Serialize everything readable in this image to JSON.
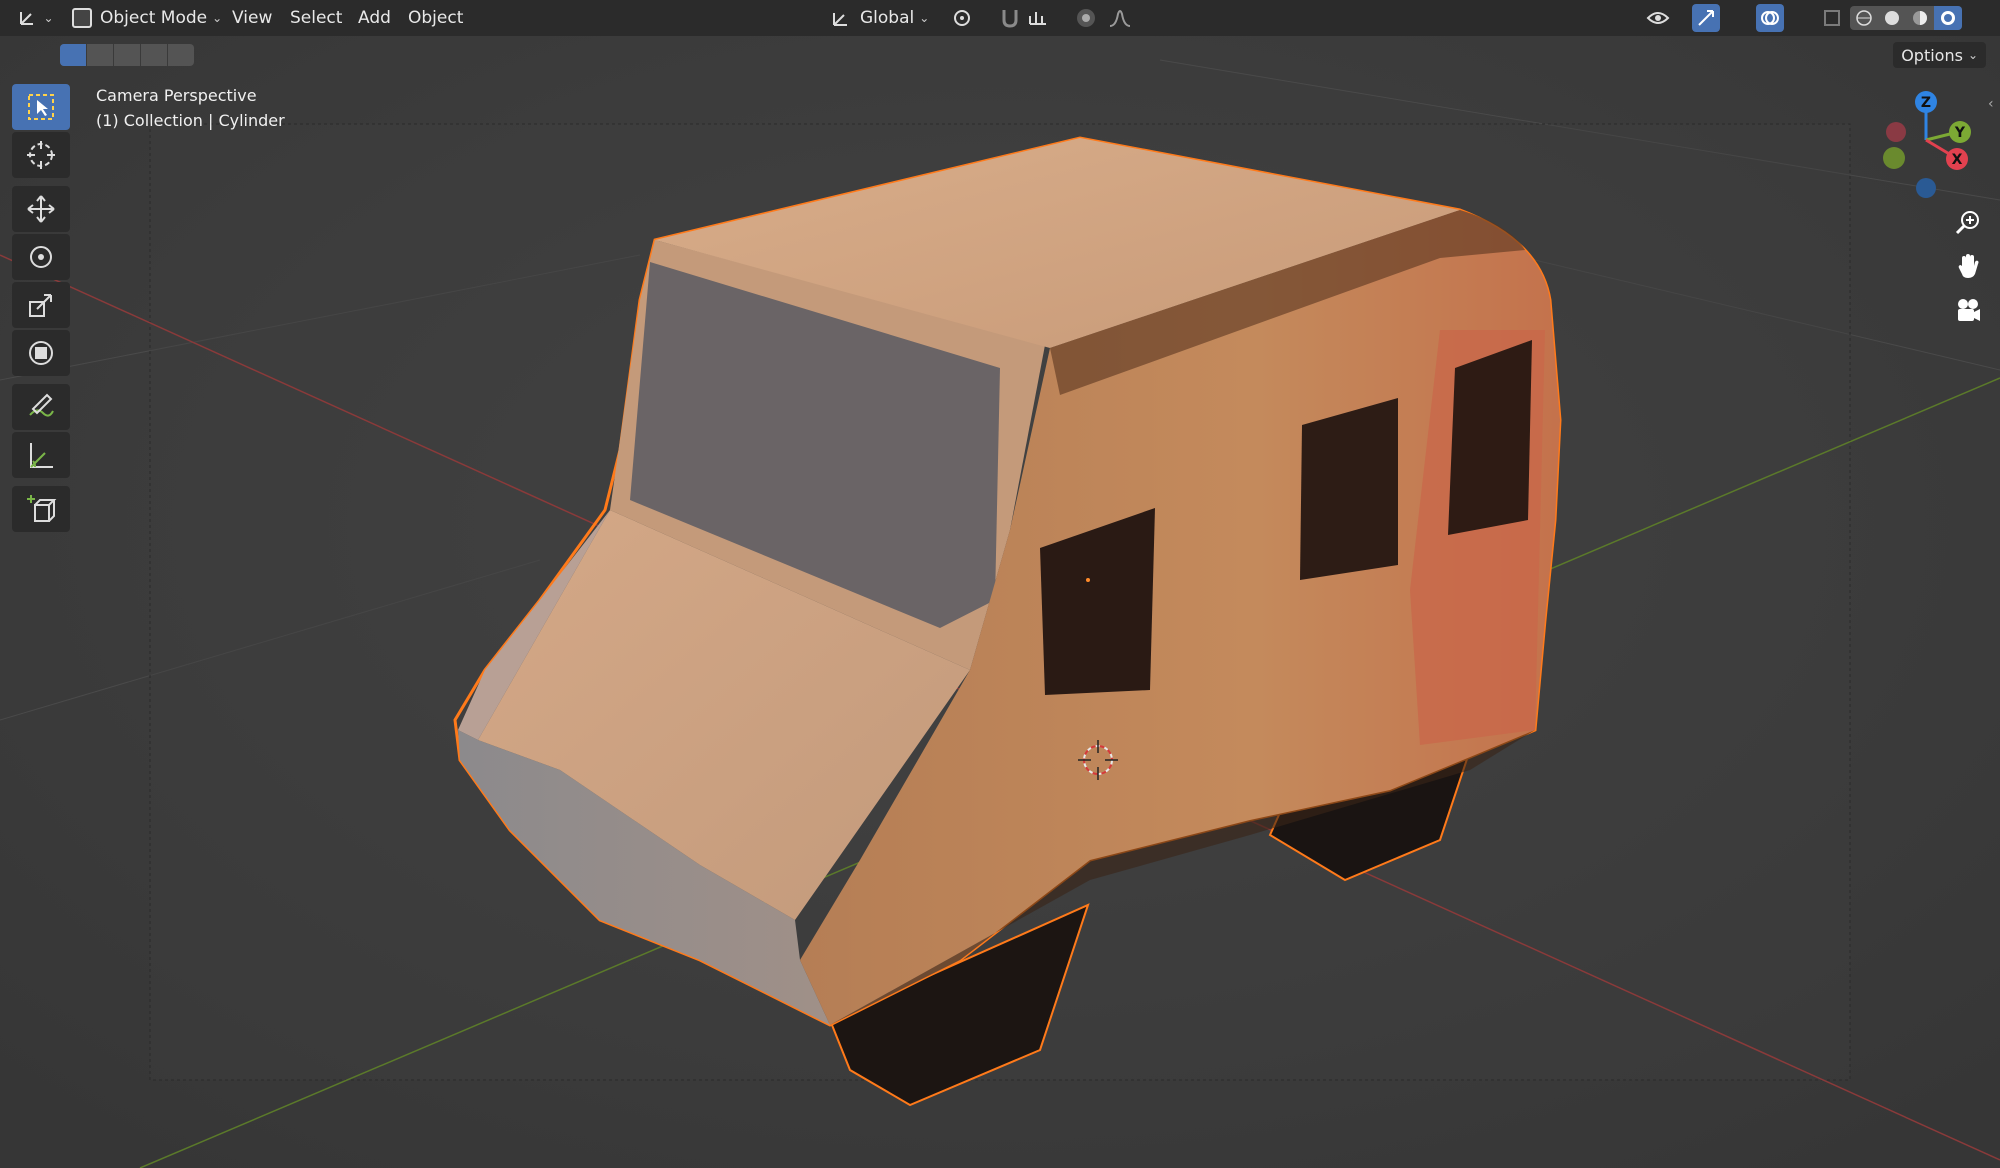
{
  "header": {
    "editor_type_icon": "orientation-axes-icon",
    "mode_label": "Object Mode",
    "menus": [
      "View",
      "Select",
      "Add",
      "Object"
    ],
    "transform_orientation": "Global",
    "options_label": "Options"
  },
  "viewport": {
    "view_name": "Camera Perspective",
    "collection_info": "(1) Collection | Cylinder"
  },
  "toolbar": {
    "tools": [
      "select-box-icon",
      "cursor-icon",
      "move-icon",
      "rotate-icon",
      "scale-icon",
      "transform-icon",
      "annotate-icon",
      "measure-icon",
      "add-cube-icon"
    ]
  },
  "gizmo": {
    "axes": [
      "Z",
      "Y",
      "X"
    ]
  },
  "colors": {
    "accent": "#4772b3",
    "selection_outline": "#ff7a1a",
    "axis_x": "#e2414f",
    "axis_y": "#7ca934",
    "axis_z": "#2f84e3"
  }
}
